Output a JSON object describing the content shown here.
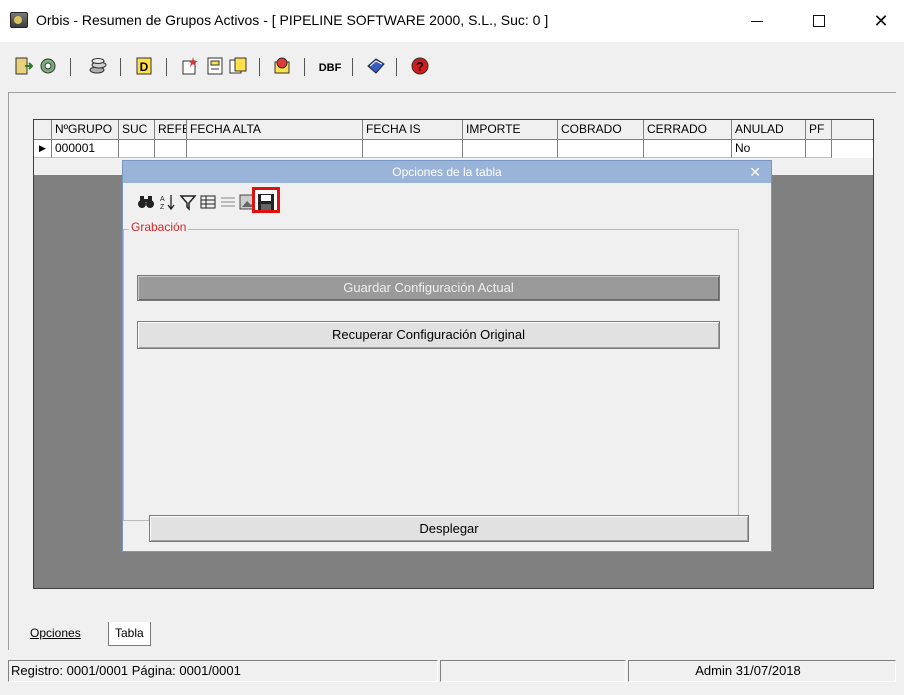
{
  "window": {
    "title": "Orbis - Resumen de Grupos Activos - [ PIPELINE SOFTWARE 2000, S.L.,  Suc: 0 ]",
    "minimize": "—",
    "maximize": "□",
    "close": "✕"
  },
  "toolbar": {
    "icons": [
      "exit-icon",
      "gear-icon",
      "coins-icon",
      "d-icon",
      "new-doc-icon",
      "form-icon",
      "copy-doc-icon",
      "open-icon",
      "dbf-icon",
      "book-icon",
      "help-icon"
    ],
    "dbf_label": "DBF",
    "d_label": "D",
    "help_label": "?"
  },
  "grid": {
    "columns": [
      "NºGRUPO",
      "SUC",
      "REFE",
      "FECHA ALTA",
      "FECHA IS",
      "IMPORTE",
      "COBRADO",
      "CERRADO",
      "ANULAD",
      "PF"
    ],
    "row": {
      "ngrupo": "000001",
      "anulado": "No"
    },
    "indicator": "▶"
  },
  "dialog": {
    "title": "Opciones de la tabla",
    "close": "✕",
    "icons": [
      "binoculars-icon",
      "sort-az-icon",
      "filter-icon",
      "columns-icon",
      "lines-icon",
      "image-icon",
      "save-icon"
    ],
    "group_label": "Grabación",
    "save_button": "Guardar Configuración Actual",
    "restore_button": "Recuperar Configuración Original",
    "expand_button": "Desplegar"
  },
  "tabs": [
    {
      "label": "Opciones"
    },
    {
      "label": "Tabla"
    }
  ],
  "status": {
    "registro": "Registro: 0001/0001  Página: 0001/0001",
    "user_date": "Admin 31/07/2018"
  },
  "colors": {
    "dialog_title_bg": "#9ab3d8",
    "highlight": "#e01010",
    "group_label": "#d12a2a",
    "grid_bg": "#808080"
  }
}
